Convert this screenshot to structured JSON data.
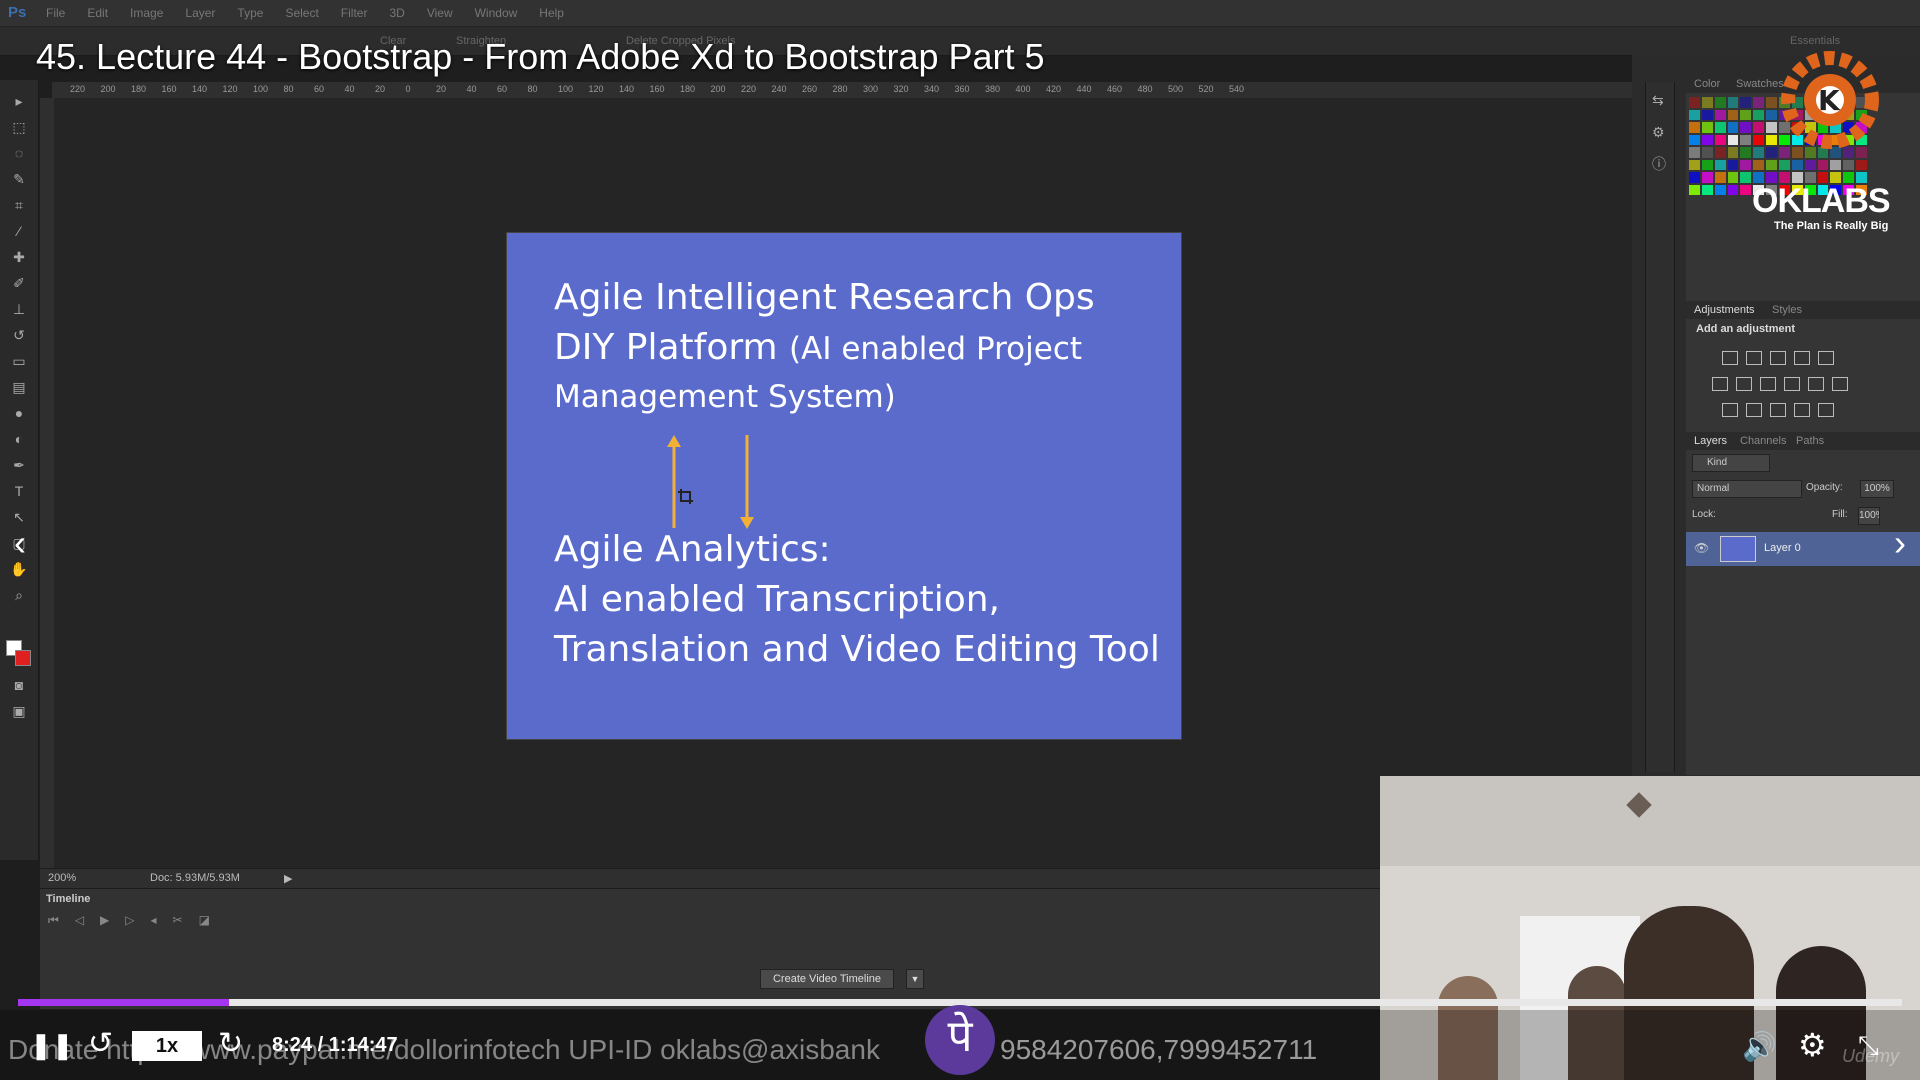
{
  "video": {
    "title": "45. Lecture 44 - Bootstrap - From Adobe Xd to Bootstrap Part 5",
    "current_time": "8:24",
    "duration": "1:14:47",
    "time_display": "8:24 / 1:14:47",
    "speed": "1x",
    "progress_fraction": 0.112,
    "accent_color": "#a435f0",
    "donate_text": "Donate https://www.paypal.me/dollorinfotech UPI-ID oklabs@axisbank",
    "phonepe_glyph": "पे",
    "phone_numbers": "9584207606,7999452711",
    "watermark": "Udemy",
    "icons": {
      "play_pause": "pause-icon",
      "rewind": "rewind-icon",
      "forward": "forward-icon",
      "volume": "volume-icon",
      "settings": "gear-icon",
      "fullscreen": "exit-fullscreen-icon",
      "prev": "chevron-left-icon",
      "next": "chevron-right-icon"
    }
  },
  "logo": {
    "name": "OKLABS",
    "tagline": "The Plan is Really Big"
  },
  "photoshop": {
    "menu": [
      "File",
      "Edit",
      "Image",
      "Layer",
      "Type",
      "Select",
      "Filter",
      "3D",
      "View",
      "Window",
      "Help"
    ],
    "options": {
      "clear": "Clear",
      "straighten": "Straighten",
      "delete_cropped": "Delete Cropped Pixels",
      "workspace": "Essentials"
    },
    "zoom": "200%",
    "doc_info": "Doc: 5.93M/5.93M",
    "ruler_marks": [
      "220",
      "200",
      "180",
      "160",
      "140",
      "120",
      "100",
      "80",
      "60",
      "40",
      "20",
      "0",
      "20",
      "40",
      "60",
      "80",
      "100",
      "120",
      "140",
      "160",
      "180",
      "200",
      "220",
      "240",
      "260",
      "280",
      "300",
      "320",
      "340",
      "360",
      "380",
      "400",
      "420",
      "440",
      "460",
      "480",
      "500",
      "520",
      "540"
    ],
    "timeline": {
      "title": "Timeline",
      "create_button": "Create Video Timeline"
    },
    "panels": {
      "color_tabs": [
        "Color",
        "Swatches"
      ],
      "adjustments_tabs": [
        "Adjustments",
        "Styles"
      ],
      "adjustments_hint": "Add an adjustment",
      "layers_tabs": [
        "Layers",
        "Channels",
        "Paths"
      ],
      "kind": "Kind",
      "blend_mode": "Normal",
      "opacity_label": "Opacity:",
      "opacity_value": "100%",
      "lock_label": "Lock:",
      "fill_label": "Fill:",
      "fill_value": "100%",
      "layer_name": "Layer 0"
    }
  },
  "slide": {
    "background": "#5a6bcc",
    "arrow_color": "#f2b134",
    "line1": "Agile Intelligent Research Ops",
    "line2_main": "DIY Platform",
    "line2_small": "(AI enabled Project",
    "line3": "Management System)",
    "line4": "Agile Analytics:",
    "line5": "AI enabled Transcription,",
    "line6": "Translation and Video Editing Tool"
  }
}
